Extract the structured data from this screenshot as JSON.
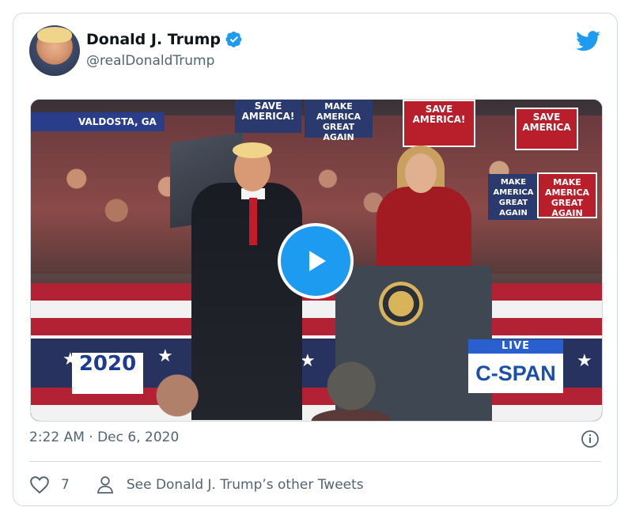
{
  "tweet": {
    "author_name": "Donald J. Trump",
    "author_handle": "@realDonaldTrump",
    "timestamp": "2:22 AM · Dec 6, 2020",
    "like_count": "7",
    "other_tweets_label": "See Donald J. Trump’s other Tweets"
  },
  "video": {
    "location_caption": "VALDOSTA, GA",
    "signs": [
      "SAVE AMERICA!",
      "MAKE AMERICA GREAT AGAIN",
      "SAVE AMERICA!",
      "SAVE AMERICA",
      "MAKE AMERICA GREAT AGAIN",
      "MAKE AMERICA GREAT AGAIN"
    ],
    "badge_2020": "2020",
    "live_label": "LIVE",
    "network": "C-SPAN"
  },
  "colors": {
    "twitter_blue": "#1d9bf0",
    "verified_blue": "#1d9bf0",
    "text_primary": "#0f1419",
    "text_secondary": "#536471",
    "border": "#cfd9de"
  },
  "icons": [
    "verified-icon",
    "twitter-bird-icon",
    "play-icon",
    "info-icon",
    "heart-icon",
    "person-icon"
  ]
}
